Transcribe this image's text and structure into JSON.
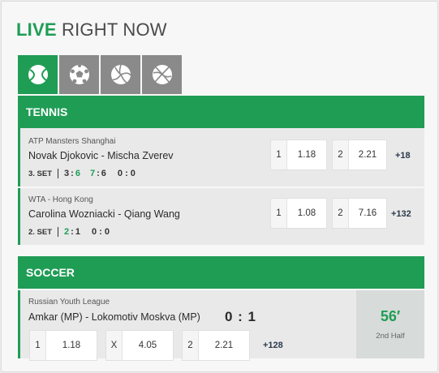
{
  "header": {
    "live": "LIVE",
    "rest": " RIGHT NOW"
  },
  "tabs": [
    {
      "icon": "tennis-ball-icon",
      "active": true
    },
    {
      "icon": "soccer-ball-icon",
      "active": false
    },
    {
      "icon": "volleyball-icon",
      "active": false
    },
    {
      "icon": "basketball-icon",
      "active": false
    }
  ],
  "tennis": {
    "title": "TENNIS",
    "matches": [
      {
        "league": "ATP Mansters Shanghai",
        "teams": "Novak Djokovic - Mischa Zverev",
        "set": "3. SET",
        "scores": [
          "3",
          ":",
          "6",
          "7",
          ":",
          "6",
          "0 : 0"
        ],
        "odds": [
          {
            "label": "1",
            "value": "1.18"
          },
          {
            "label": "2",
            "value": "2.21"
          }
        ],
        "more": "+18"
      },
      {
        "league": "WTA - Hong Kong",
        "teams": "Carolina Wozniacki - Qiang Wang",
        "set": "2. SET",
        "scores": [
          "2",
          ":",
          "1",
          "0 : 0"
        ],
        "odds": [
          {
            "label": "1",
            "value": "1.08"
          },
          {
            "label": "2",
            "value": "7.16"
          }
        ],
        "more": "+132"
      }
    ]
  },
  "soccer": {
    "title": "SOCCER",
    "match": {
      "league": "Russian Youth League",
      "teams": "Amkar (MP) - Lokomotiv Moskva (MP)",
      "score": "0 : 1",
      "odds": [
        {
          "label": "1",
          "value": "1.18"
        },
        {
          "label": "X",
          "value": "4.05"
        },
        {
          "label": "2",
          "value": "2.21"
        }
      ],
      "more": "+128",
      "minute": "56′",
      "period": "2nd Half"
    }
  },
  "colors": {
    "accent": "#1f9d55",
    "tab_inactive": "#8a8a8a"
  }
}
